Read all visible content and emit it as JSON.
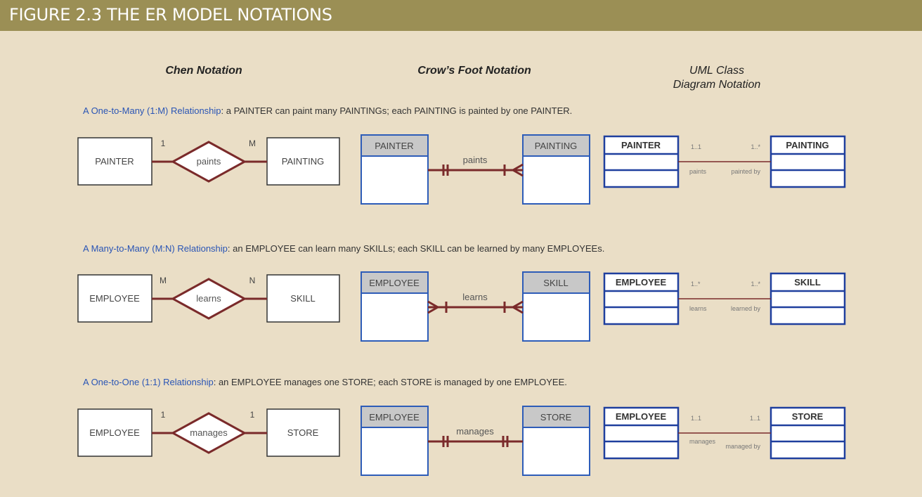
{
  "figure": {
    "title": "FIGURE 2.3  THE ER MODEL NOTATIONS",
    "colors": {
      "header_bg": "#9b8f55",
      "background": "#eadec6",
      "relationship_line": "#7a2a2a",
      "crowsfoot_border": "#2d5cb8",
      "uml_border": "#1f3f9e",
      "crowsfoot_header": "#c8c8c8",
      "description_lead": "#2a55b5"
    }
  },
  "columns": [
    {
      "label": "Chen Notation"
    },
    {
      "label": "Crow’s Foot Notation"
    },
    {
      "label_line1": "UML Class",
      "label_line2": "Diagram Notation"
    }
  ],
  "relationships": [
    {
      "lead": "A One-to-Many (1:M) Relationship",
      "text": ": a PAINTER can paint many PAINTINGs; each PAINTING is painted by one PAINTER.",
      "chen": {
        "left_entity": "PAINTER",
        "relationship": "paints",
        "right_entity": "PAINTING",
        "left_card": "1",
        "right_card": "M"
      },
      "crowsfoot": {
        "left_entity": "PAINTER",
        "relationship": "paints",
        "right_entity": "PAINTING",
        "left_end": "one-mandatory",
        "right_end": "many-mandatory"
      },
      "uml": {
        "left_class": "PAINTER",
        "right_class": "PAINTING",
        "left_mult": "1..1",
        "right_mult": "1..*",
        "left_role": "paints",
        "right_role": "painted by"
      }
    },
    {
      "lead": "A Many-to-Many (M:N) Relationship",
      "text": ": an EMPLOYEE can learn many SKILLs; each SKILL can be learned by many EMPLOYEEs.",
      "chen": {
        "left_entity": "EMPLOYEE",
        "relationship": "learns",
        "right_entity": "SKILL",
        "left_card": "M",
        "right_card": "N"
      },
      "crowsfoot": {
        "left_entity": "EMPLOYEE",
        "relationship": "learns",
        "right_entity": "SKILL",
        "left_end": "many-mandatory",
        "right_end": "many-mandatory"
      },
      "uml": {
        "left_class": "EMPLOYEE",
        "right_class": "SKILL",
        "left_mult": "1..*",
        "right_mult": "1..*",
        "left_role": "learns",
        "right_role": "learned by"
      }
    },
    {
      "lead": "A One-to-One (1:1) Relationship",
      "text": ": an EMPLOYEE manages one STORE; each STORE is managed by one EMPLOYEE.",
      "chen": {
        "left_entity": "EMPLOYEE",
        "relationship": "manages",
        "right_entity": "STORE",
        "left_card": "1",
        "right_card": "1"
      },
      "crowsfoot": {
        "left_entity": "EMPLOYEE",
        "relationship": "manages",
        "right_entity": "STORE",
        "left_end": "one-mandatory",
        "right_end": "one-mandatory"
      },
      "uml": {
        "left_class": "EMPLOYEE",
        "right_class": "STORE",
        "left_mult": "1..1",
        "right_mult": "1..1",
        "left_role": "manages",
        "right_role": "managed by"
      }
    }
  ]
}
